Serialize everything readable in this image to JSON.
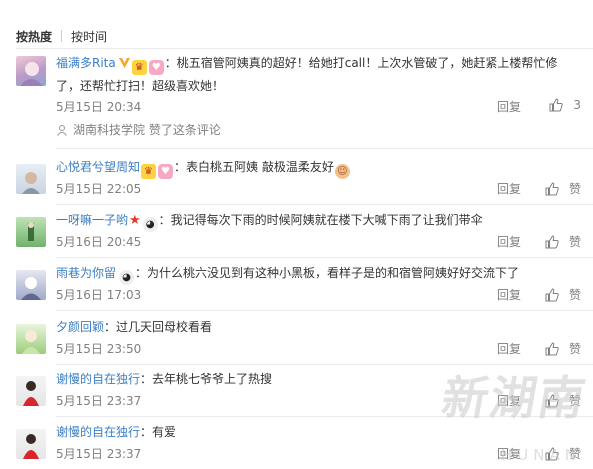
{
  "tabs": {
    "hot": "按热度",
    "time": "按时间"
  },
  "comments": [
    {
      "user": "福满多Rita",
      "text_line1": "：桃五宿管阿姨真的超好！给她打call！上次水管破了，她赶紧上楼帮忙修",
      "text_line2": "了，还帮忙打扫！超级喜欢她！",
      "time": "5月15日 20:34",
      "reply": "回复",
      "like_count": "3",
      "liked_by": "湖南科技学院",
      "liked_text": "赞了这条评论"
    },
    {
      "user": "心悦君兮望周知",
      "text": "：表白桃五阿姨 敲极温柔友好",
      "time": "5月15日 22:05",
      "reply": "回复",
      "like": "赞"
    },
    {
      "user": "一呀嘛一子哟",
      "text": "：我记得每次下雨的时候阿姨就在楼下大喊下雨了让我们带伞",
      "time": "5月16日 20:45",
      "reply": "回复",
      "like": "赞"
    },
    {
      "user": "雨巷为你留",
      "text": "：为什么桃六没见到有这种小黑板，看样子是的和宿管阿姨好好交流下了",
      "time": "5月16日 17:03",
      "reply": "回复",
      "like": "赞"
    },
    {
      "user": "夕颜回颖",
      "text": "：过几天回母校看看",
      "time": "5月15日 23:50",
      "reply": "回复",
      "like": "赞"
    },
    {
      "user": "谢慢的自在独行",
      "text": "：去年桃七爷爷上了热搜",
      "time": "5月15日 23:37",
      "reply": "回复",
      "like": "赞"
    },
    {
      "user": "谢慢的自在独行",
      "text": "：有爱",
      "time": "5月15日 23:37",
      "reply": "回复",
      "like": "赞"
    }
  ],
  "watermark": {
    "main": "新湖南",
    "sub": "HUNAN"
  },
  "colors": {
    "name_orange": "#eb7350",
    "name_blue": "#3b7fc4",
    "meta_gray": "#808080"
  }
}
